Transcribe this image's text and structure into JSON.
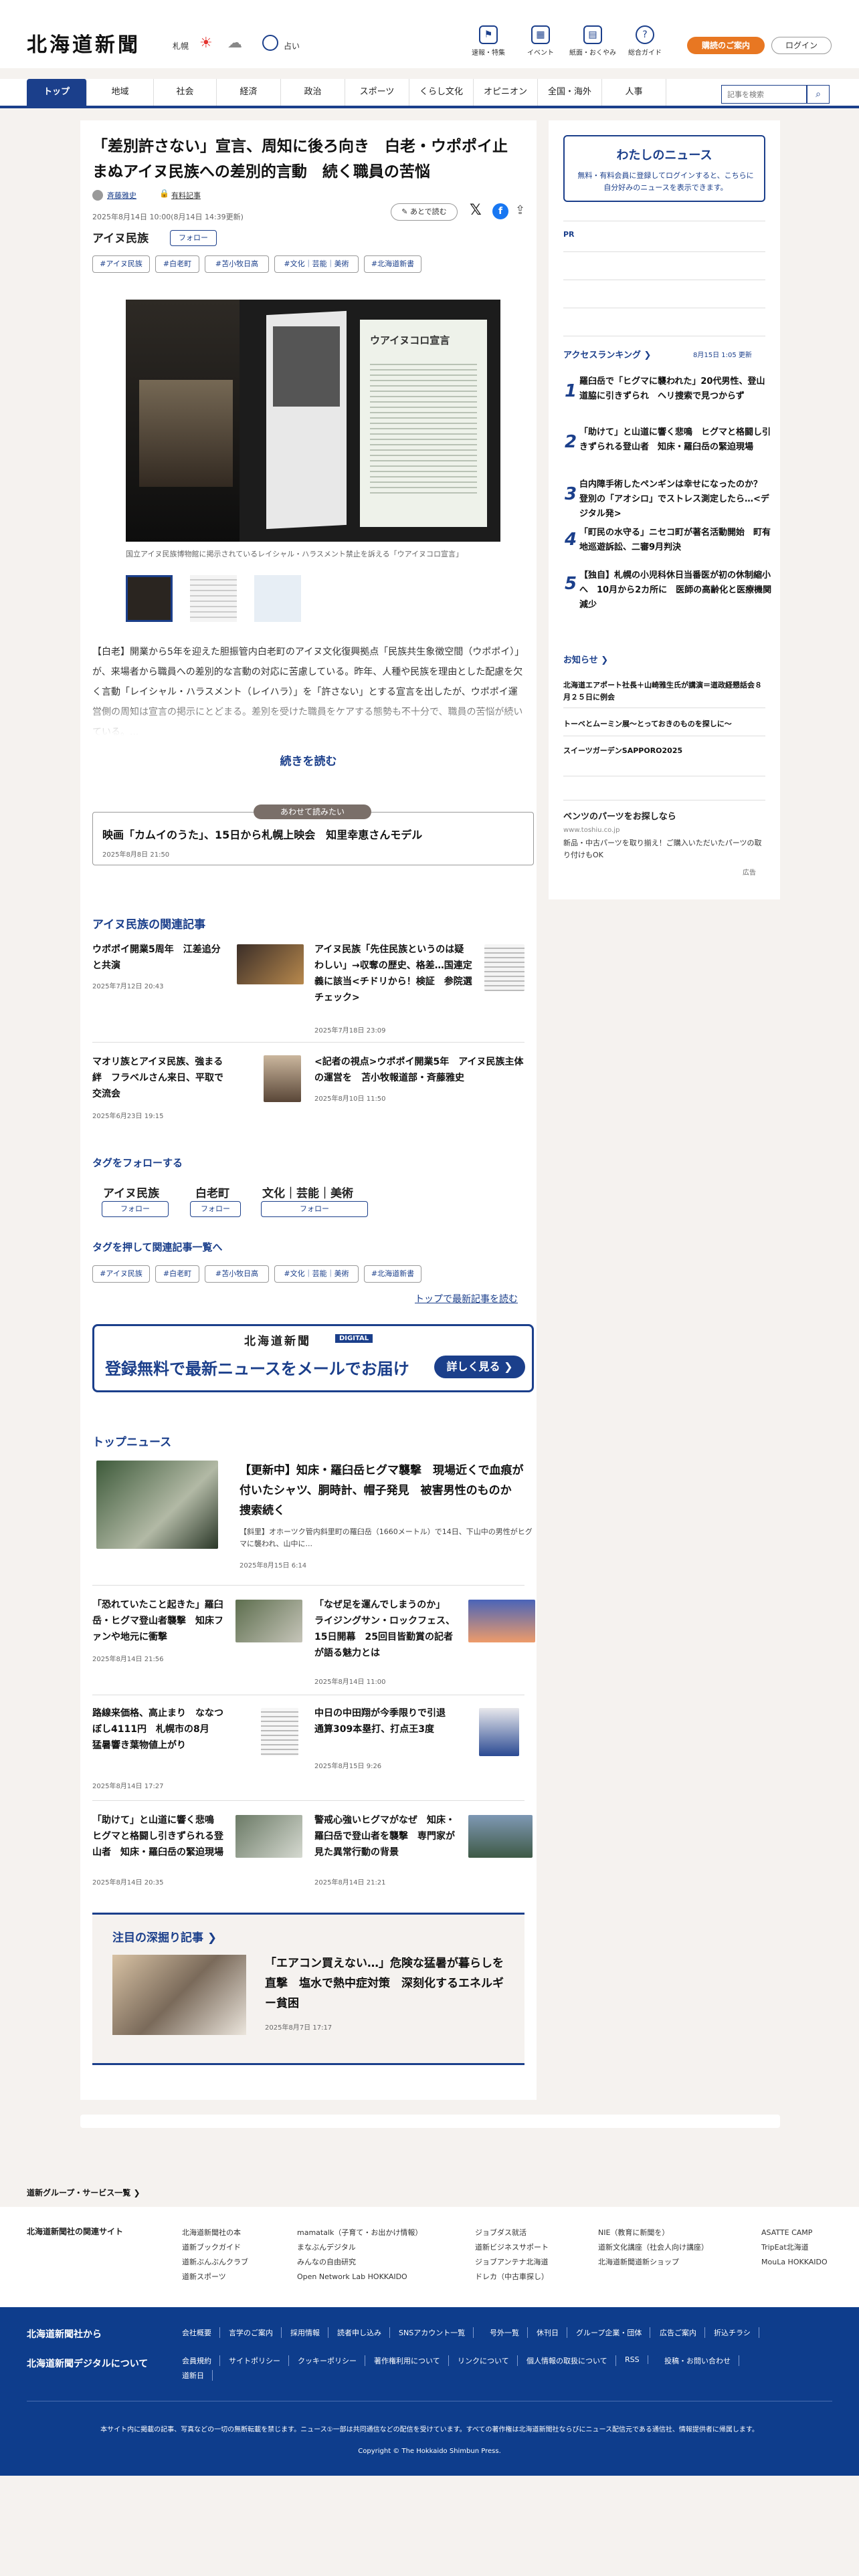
{
  "header": {
    "logo": "北海道新聞",
    "weather": {
      "city": "札幌",
      "city2": "占い",
      "sun": "☀",
      "cloud": "☁"
    },
    "icons": [
      {
        "label": "速報・特集",
        "icon": "flag-icon"
      },
      {
        "label": "イベント",
        "icon": "calendar-icon"
      },
      {
        "label": "紙面・おくやみ",
        "icon": "newspaper-icon"
      },
      {
        "label": "総合ガイド",
        "icon": "help-icon"
      }
    ],
    "subscribe": "購読のご案内",
    "login": "ログイン"
  },
  "nav": {
    "items": [
      "トップ",
      "地域",
      "社会",
      "経済",
      "政治",
      "スポーツ",
      "くらし文化",
      "オピニオン",
      "全国・海外",
      "人事"
    ],
    "search_placeholder": "記事を検索"
  },
  "article": {
    "title": "「差別許さない」宣言、周知に後ろ向き　白老・ウポポイ止まぬアイヌ民族への差別的言動　続く職員の苦悩",
    "author": "斉藤雅史",
    "paid": "有料記事",
    "dates": "2025年8月14日 10:00(8月14日 14:39更新)",
    "save": "あとで読む",
    "topic": "アイヌ民族",
    "follow": "フォロー",
    "tags": [
      "#アイヌ民族",
      "#白老町",
      "#苫小牧日高",
      "#文化｜芸能｜美術",
      "#北海道新書"
    ],
    "caption": "国立アイヌ民族博物館に掲示されているレイシャル・ハラスメント禁止を訴える「ウアイヌコロ宣言」",
    "photo_text": "ウアイヌコロ宣言",
    "body": "【白老】開業から5年を迎えた胆振管内白老町のアイヌ文化復興拠点「民族共生象徴空間（ウポポイ）」が、来場者から職員への差別的な言動の対応に苦慮している。昨年、人種や民族を理由とした配慮を欠く言動「レイシャル・ハラスメント（レイハラ）」を「許さない」とする宣言を出したが、ウポポイ運営側の周知は宣言の掲示にとどまる。差別を受けた職員をケアする態勢も不十分で、職員の苦悩が続いている。...",
    "read_more": "続きを読む",
    "also_label": "あわせて読みたい",
    "also_title": "映画「カムイのうた」、15日から札幌上映会　知里幸恵さんモデル",
    "also_date": "2025年8月8日 21:50"
  },
  "related": {
    "heading": "アイヌ民族の関連記事",
    "items": [
      {
        "title": "ウポポイ開業5周年　江差追分と共演",
        "date": "2025年7月12日 20:43"
      },
      {
        "title": "アイヌ民族「先住民族というのは疑わしい」→収奪の歴史、格差…国連定義に該当<チドリから！検証　参院選チェック>",
        "date": "2025年7月18日 23:09"
      },
      {
        "title": "マオリ族とアイヌ民族、強まる絆　フラベルさん来日、平取で交流会",
        "date": "2025年6月23日 19:15"
      },
      {
        "title": "<記者の視点>ウポポイ開業5年　アイヌ民族主体の運営を　苫小牧報道部・斉藤雅史",
        "date": "2025年8月10日 11:50"
      }
    ]
  },
  "follow_tags": {
    "heading": "タグをフォローする",
    "items": [
      "アイヌ民族",
      "白老町",
      "文化｜芸能｜美術"
    ],
    "btn": "フォロー"
  },
  "tag_list": {
    "heading": "タグを押して関連記事一覧へ",
    "items": [
      "#アイヌ民族",
      "#白老町",
      "#苫小牧日高",
      "#文化｜芸能｜美術",
      "#北海道新書"
    ],
    "latest": "トップで最新記事を読む"
  },
  "banner": {
    "brand": "北海道新聞",
    "digital": "DIGITAL",
    "text": "登録無料で最新ニュースをメールでお届け",
    "btn": "詳しく見る"
  },
  "top_news": {
    "heading": "トップニュース",
    "lead": {
      "title": "【更新中】知床・羅臼岳ヒグマ襲撃　現場近くで血痕が付いたシャツ、胴時計、帽子発見　被害男性のものか　捜索続く",
      "body": "【斜里】オホーツク管内斜里町の羅臼岳（1660メートル）で14日、下山中の男性がヒグマに襲われ、山中に...",
      "date": "2025年8月15日 6:14"
    },
    "items": [
      {
        "title": "「恐れていたこと起きた」羅臼岳・ヒグマ登山者襲撃　知床ファンや地元に衝撃",
        "date": "2025年8月14日 21:56"
      },
      {
        "title": "「なぜ足を運んでしまうのか」 ライジングサン・ロックフェス、15日開幕　25回目皆勤賞の記者が語る魅力とは",
        "date": "2025年8月14日 11:00"
      },
      {
        "title": "路線来価格、高止まり　ななつぼし4111円　札幌市の8月　猛暑響き葉物値上がり",
        "date": "2025年8月14日 17:27"
      },
      {
        "title": "中日の中田翔が今季限りで引退　通算309本塁打、打点王3度",
        "date": "2025年8月15日 9:26"
      },
      {
        "title": "「助けて」と山道に響く悲鳴　ヒグマと格闘し引きずられる登山者　知床・羅臼岳の緊迫現場",
        "date": "2025年8月14日 20:35"
      },
      {
        "title": "警戒心強いヒグマがなぜ　知床・羅臼岳で登山者を襲撃　専門家が見た異常行動の背景",
        "date": "2025年8月14日 21:21"
      }
    ]
  },
  "deep": {
    "heading": "注目の深掘り記事",
    "title": "「エアコン買えない…」危険な猛暑が暮らしを直撃　塩水で熱中症対策　深刻化するエネルギー貧困",
    "date": "2025年8月7日 17:17"
  },
  "sidebar": {
    "my_news_title": "わたしのニュース",
    "my_news_text": "無料・有料会員に登録してログインすると、こちらに自分好みのニュースを表示できます。",
    "login_word": "ログイン",
    "pr": "PR",
    "ranking_title": "アクセスランキング",
    "ranking_date": "8月15日 1:05 更新",
    "ranking": [
      {
        "num": "1",
        "title": "羅臼岳で「ヒグマに襲われた」20代男性、登山道脇に引きずられ　ヘリ捜索で見つからず"
      },
      {
        "num": "2",
        "title": "「助けて」と山道に響く悲鳴　ヒグマと格闘し引きずられる登山者　知床・羅臼岳の緊迫現場"
      },
      {
        "num": "3",
        "title": "白内障手術したペンギンは幸せになったのか？　登別の「アオシロ」でストレス測定したら…<デジタル発>"
      },
      {
        "num": "4",
        "title": "「町民の水守る」ニセコ町が著名活動開始　町有地巡遊訴訟、二審9月判決"
      },
      {
        "num": "5",
        "title": "【独自】札幌の小児科休日当番医が初の休制縮小へ　10月から2カ所に　医師の高齢化と医療機関減少"
      }
    ],
    "notice_title": "お知らせ",
    "notices": [
      "北海道エアポート社長＋山崎雅生氏が講演＝道政経懇話会８月２５日に例会",
      "トーベとムーミン展〜とっておきのものを探しに〜",
      "スイーツガーデンSAPPORO2025"
    ],
    "ad_title": "ベンツのパーツをお探しなら",
    "ad_url": "www.toshiu.co.jp",
    "ad_text": "新品・中古パーツを取り揃え！ご購入いただいたパーツの取り付けもOK",
    "ad_label": "広告"
  },
  "footer": {
    "group": "道新グループ・サービス一覧",
    "related": "北海道新聞社の関連サイト",
    "cols": [
      [
        "北海道新聞社の本",
        "道新ブックガイド",
        "道新ぶんぶんクラブ",
        "道新スポーツ"
      ],
      [
        "mamatalk（子育て・お出かけ情報）",
        "まなぶんデジタル",
        "みんなの自由研究",
        "Open Network Lab HOKKAIDO"
      ],
      [
        "ジョブダス就活",
        "道新ビジネスサポート",
        "ジョブアンテナ北海道",
        "ドレカ（中古車探し）"
      ],
      [
        "NIE（教育に新聞を）",
        "道新文化講座（社会人向け講座）",
        "北海道新聞道新ショップ"
      ],
      [
        "ASATTE CAMP",
        "TripEat北海道",
        "MouLa HOKKAIDO"
      ]
    ],
    "about": "北海道新聞社から",
    "digital": "北海道新聞デジタルについて",
    "links1": [
      "会社概要",
      "言学のご案内",
      "採用情報",
      "読者申し込み",
      "SNSアカウント一覧",
      "号外一覧",
      "休刊日",
      "グループ企業・団体",
      "広告ご案内",
      "折込チラシ"
    ],
    "links2": [
      "会員規約",
      "サイトポリシー",
      "クッキーポリシー",
      "著作権利用について",
      "リンクについて",
      "個人情報の取扱について",
      "RSS",
      "投稿・お問い合わせ",
      "道新日"
    ],
    "note": "本サイト内に掲載の記事、写真などの一切の無断転載を禁じます。ニュース①一部は共同通信などの配信を受けています。すべての著作権は北海道新聞社ならびにニュース配信元である通信社、情報提供者に帰属します。",
    "copyright": "Copyright © The Hokkaido Shimbun Press."
  }
}
